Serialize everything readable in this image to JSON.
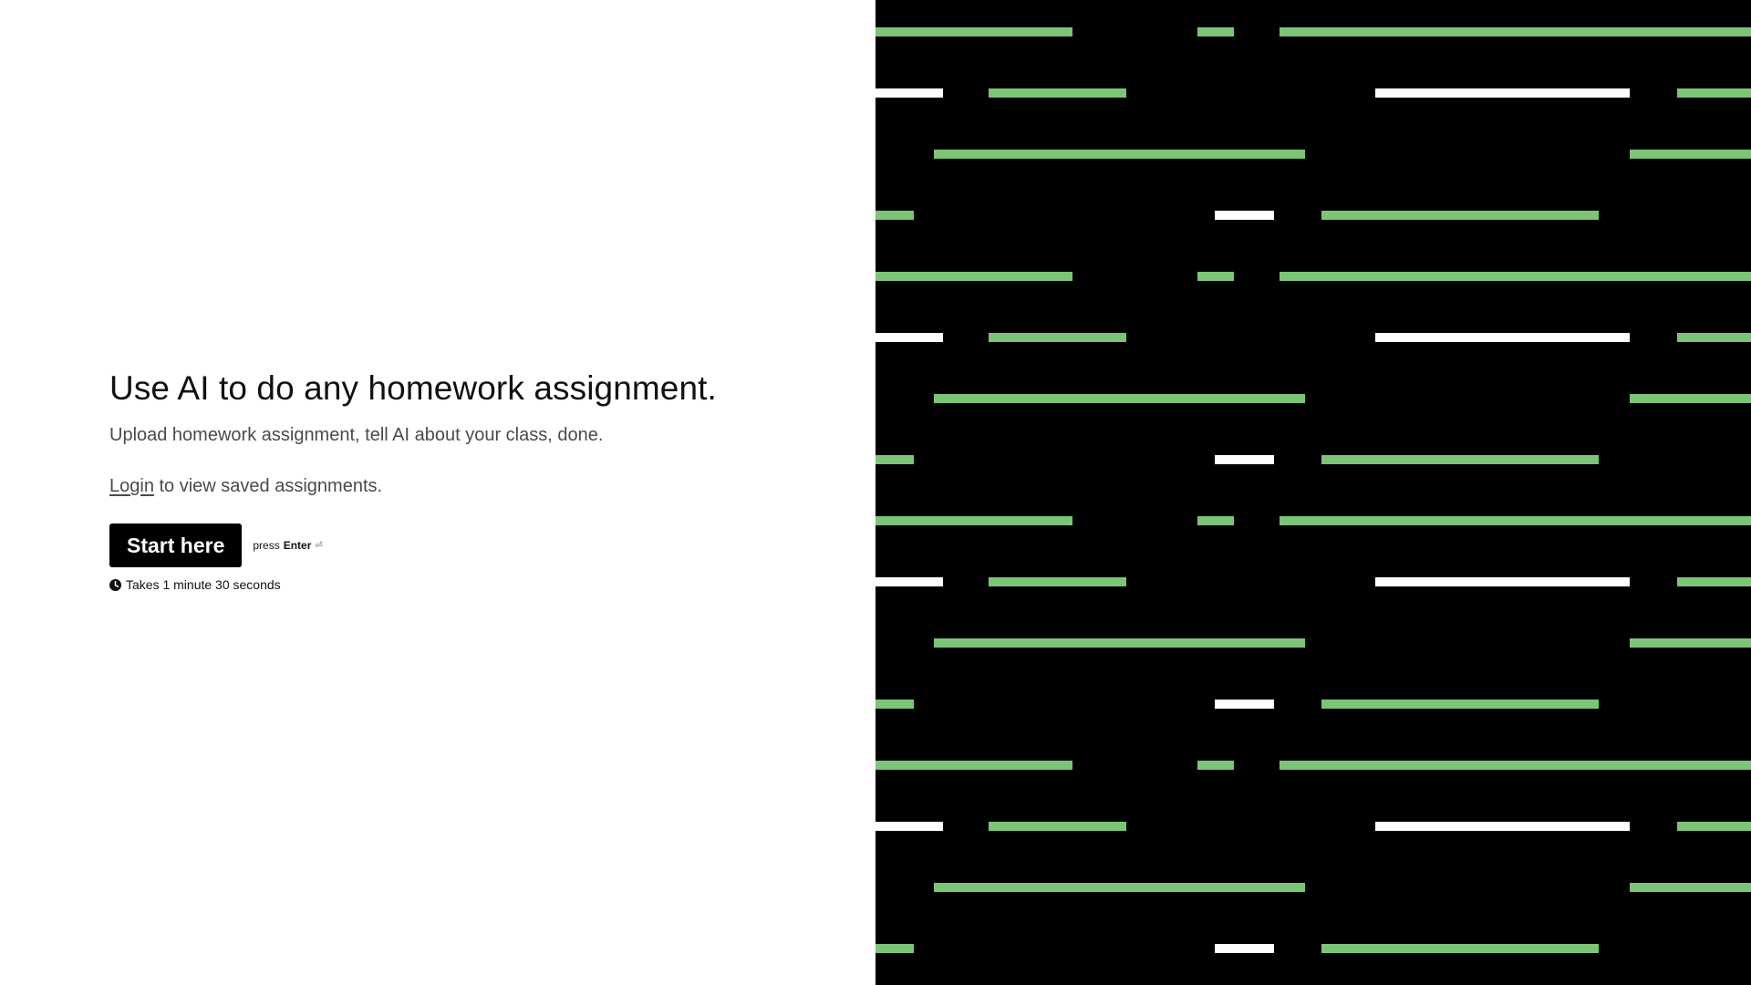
{
  "hero": {
    "headline": "Use AI to do any homework assignment.",
    "subhead": "Upload homework assignment, tell AI about your class, done.",
    "login_link": "Login",
    "login_suffix": " to view saved assignments.",
    "start_button": "Start here",
    "hint_prefix": "press",
    "hint_key": "Enter",
    "hint_glyph": "⏎",
    "duration": "Takes 1 minute 30 seconds"
  },
  "icons": {
    "clock": "clock-icon",
    "enter": "enter-key-icon"
  },
  "colors": {
    "background": "#ffffff",
    "panel": "#000000",
    "button": "#000000",
    "accent_green": "#7cc576",
    "accent_white": "#ffffff",
    "text_primary": "#111111",
    "text_secondary": "#4a4a4a"
  }
}
